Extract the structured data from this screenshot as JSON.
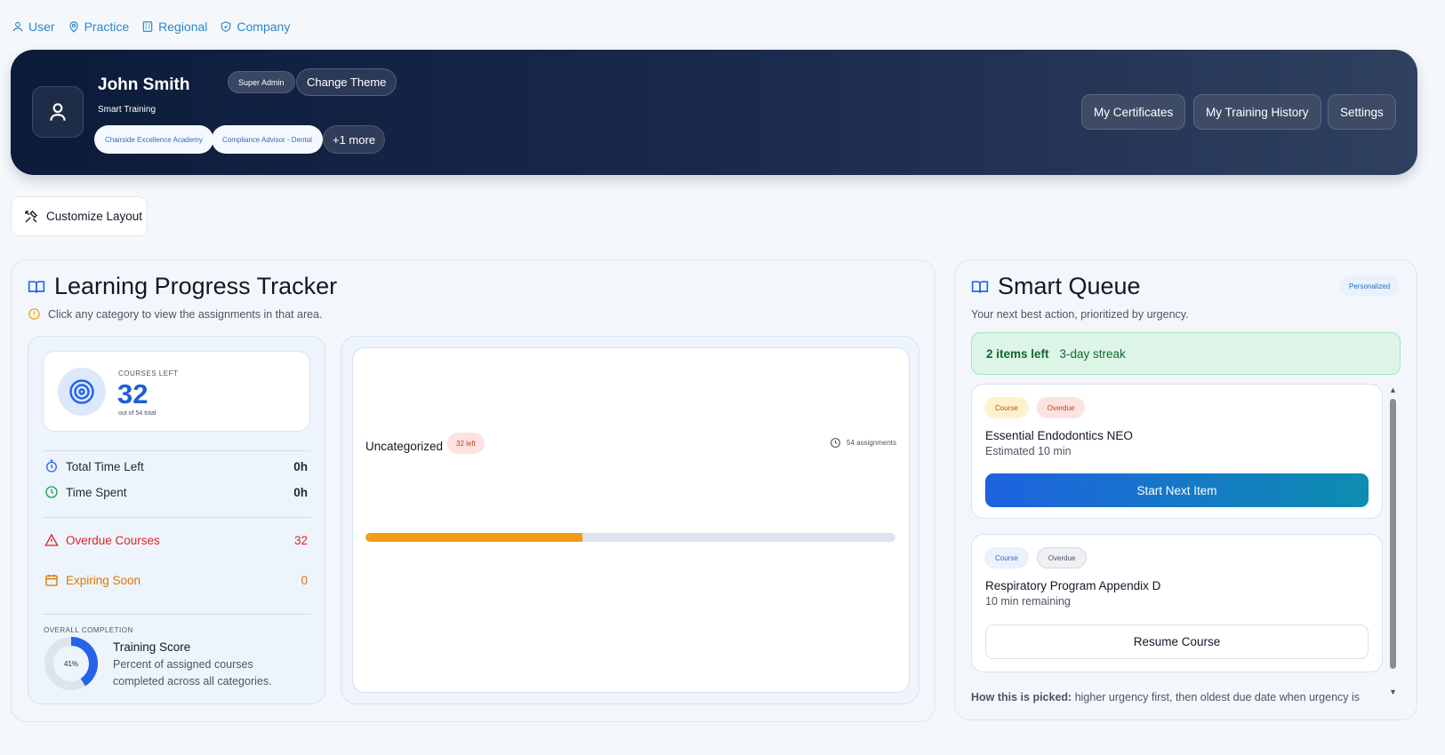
{
  "scopes": [
    {
      "label": "User",
      "icon": "user-icon"
    },
    {
      "label": "Practice",
      "icon": "map-pin-icon"
    },
    {
      "label": "Regional",
      "icon": "building-icon"
    },
    {
      "label": "Company",
      "icon": "shield-icon"
    }
  ],
  "profile": {
    "name": "John Smith",
    "role_badge": "Super Admin",
    "change_theme_label": "Change Theme",
    "subtitle": "Smart Training",
    "org_chips": [
      "Chairside Excellence Academy",
      "Compliance Advisor - Dental"
    ],
    "more_chip": "+1 more",
    "actions": [
      "My Certificates",
      "My Training History",
      "Settings"
    ]
  },
  "customize_label": "Customize Layout",
  "tracker": {
    "title": "Learning Progress Tracker",
    "hint": "Click any category to view the assignments in that area.",
    "courses_left_label": "COURSES LEFT",
    "courses_left_value": "32",
    "courses_total_text": "out of 54 total",
    "stats": [
      {
        "label": "Total Time Left",
        "value": "0h",
        "icon": "stopwatch-icon"
      },
      {
        "label": "Time Spent",
        "value": "0h",
        "icon": "clock-icon"
      }
    ],
    "alerts": [
      {
        "label": "Overdue Courses",
        "value": "32",
        "icon": "warning-icon",
        "color": "#dc2626"
      },
      {
        "label": "Expiring Soon",
        "value": "0",
        "icon": "calendar-icon",
        "color": "#d97706"
      }
    ],
    "overall_label": "OVERALL COMPLETION",
    "score_percent_text": "41%",
    "score_percent": 41,
    "score_title": "Training Score",
    "score_desc": "Percent of assigned courses completed across all categories.",
    "category": {
      "name": "Uncategorized",
      "left_badge": "32 left",
      "assignments_text": "54 assignments",
      "progress": 0.41,
      "progress_color": "#f29d17"
    }
  },
  "queue": {
    "title": "Smart Queue",
    "badge": "Personalized",
    "subtitle": "Your next best action, prioritized by urgency.",
    "items_left": "2 items left",
    "streak": "3-day streak",
    "items": [
      {
        "tags": [
          "Course",
          "Overdue"
        ],
        "title": "Essential Endodontics NEO",
        "meta": "Estimated 10 min",
        "button": "Start Next Item"
      },
      {
        "tags": [
          "Course",
          "Overdue"
        ],
        "title": "Respiratory Program Appendix D",
        "meta": "10 min remaining",
        "button": "Resume Course"
      }
    ],
    "explain_label": "How this is picked:",
    "explain_text": "higher urgency first, then oldest due date when urgency is"
  },
  "colors": {
    "accent": "#2563eb",
    "hero_start": "#0d1b3a",
    "hero_end": "#2f415f",
    "overdue": "#dc2626",
    "expiring": "#d97706",
    "success": "#166534"
  }
}
